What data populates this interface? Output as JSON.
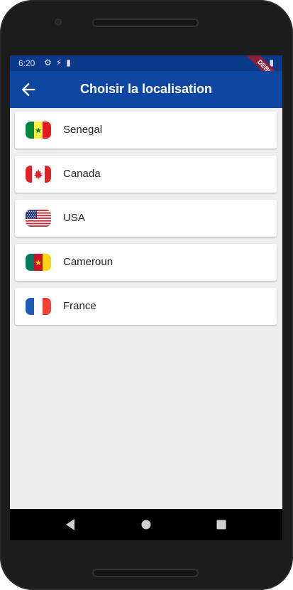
{
  "status_bar": {
    "time": "6:20",
    "debug_label": "DEBUG"
  },
  "app_bar": {
    "title": "Choisir la localisation"
  },
  "locations": [
    {
      "label": "Senegal"
    },
    {
      "label": "Canada"
    },
    {
      "label": "USA"
    },
    {
      "label": "Cameroun"
    },
    {
      "label": "France"
    }
  ],
  "colors": {
    "app_bar": "#0d47a1",
    "status_bar": "#0b3a8a",
    "background": "#eeeeee"
  }
}
